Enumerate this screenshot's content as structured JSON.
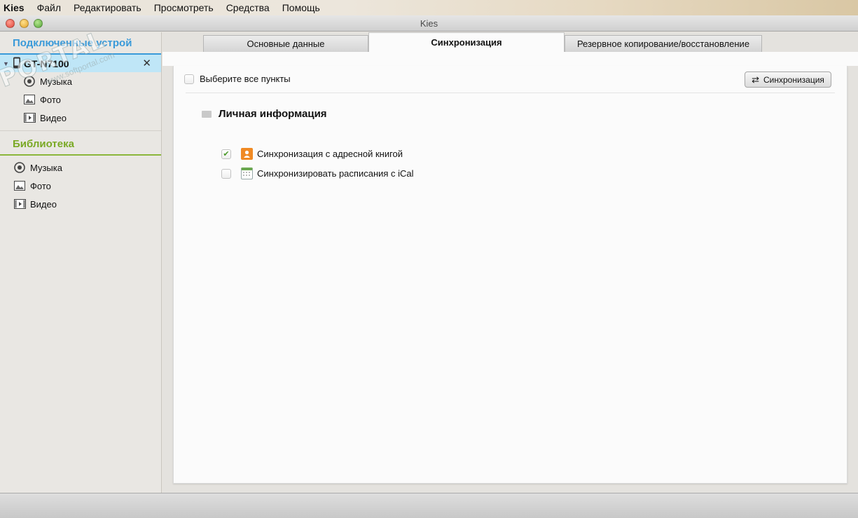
{
  "menubar": {
    "app": "Kies",
    "items": [
      "Файл",
      "Редактировать",
      "Просмотреть",
      "Средства",
      "Помощь"
    ]
  },
  "window": {
    "title": "Kies"
  },
  "sidebar": {
    "connected_header": "Подключенные устрой",
    "device_name": "GT-N7100",
    "device_items": [
      {
        "label": "Музыка",
        "icon": "music-icon"
      },
      {
        "label": "Фото",
        "icon": "photo-icon"
      },
      {
        "label": "Видео",
        "icon": "video-icon"
      }
    ],
    "library_header": "Библиотека",
    "library_items": [
      {
        "label": "Музыка",
        "icon": "music-icon"
      },
      {
        "label": "Фото",
        "icon": "photo-icon"
      },
      {
        "label": "Видео",
        "icon": "video-icon"
      }
    ]
  },
  "tabs": [
    {
      "label": "Основные данные",
      "active": false
    },
    {
      "label": "Синхронизация",
      "active": true
    },
    {
      "label": "Резервное копирование/восстановление",
      "active": false
    }
  ],
  "sync": {
    "select_all_label": "Выберите все пункты",
    "sync_button_label": "Синхронизация",
    "section_title": "Личная информация",
    "items": [
      {
        "label": "Синхронизация с адресной книгой",
        "checked": true,
        "icon": "contacts-icon"
      },
      {
        "label": "Синхронизировать расписания с iCal",
        "checked": false,
        "icon": "calendar-icon"
      }
    ]
  },
  "watermark": {
    "big": "PORTAL",
    "small": "www.softportal.com"
  },
  "colors": {
    "connected_header": "#3a9ad9",
    "library_header": "#7aa925",
    "device_highlight": "#bfe6f7"
  }
}
